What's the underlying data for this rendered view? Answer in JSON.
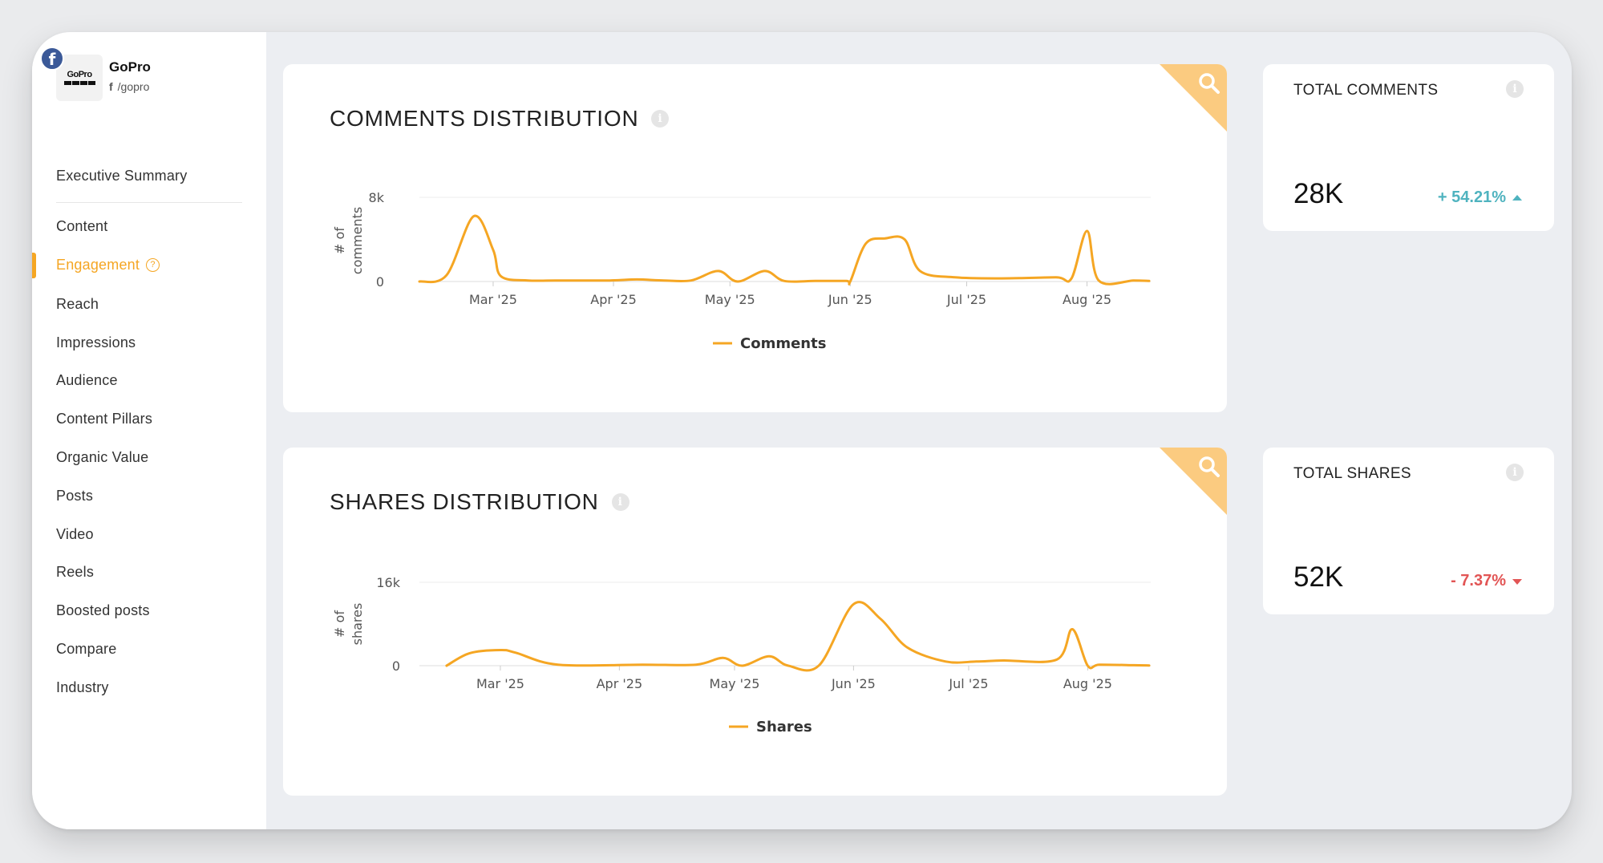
{
  "profile": {
    "name": "GoPro",
    "handle": "/gopro",
    "logo_text": "GoPro",
    "network_icon": "facebook-icon"
  },
  "nav": {
    "items": [
      {
        "label": "Executive Summary"
      },
      {
        "label": "Content"
      },
      {
        "label": "Engagement",
        "active": true
      },
      {
        "label": "Reach"
      },
      {
        "label": "Impressions"
      },
      {
        "label": "Audience"
      },
      {
        "label": "Content Pillars"
      },
      {
        "label": "Organic Value"
      },
      {
        "label": "Posts"
      },
      {
        "label": "Video"
      },
      {
        "label": "Reels"
      },
      {
        "label": "Boosted posts"
      },
      {
        "label": "Compare"
      },
      {
        "label": "Industry"
      }
    ]
  },
  "colors": {
    "accent": "#f5a623",
    "corner": "#fbcb80",
    "positive": "#4fb3bf",
    "negative": "#e25555",
    "facebook": "#3b5998"
  },
  "comments_card": {
    "title": "COMMENTS DISTRIBUTION",
    "ylabel_line1": "# of",
    "ylabel_line2": "comments",
    "legend": "Comments"
  },
  "shares_card": {
    "title": "SHARES DISTRIBUTION",
    "ylabel_line1": "# of",
    "ylabel_line2": "shares",
    "legend": "Shares"
  },
  "stats": {
    "comments": {
      "label": "TOTAL COMMENTS",
      "value": "28K",
      "change": "+ 54.21%",
      "direction": "up"
    },
    "shares": {
      "label": "TOTAL SHARES",
      "value": "52K",
      "change": "- 7.37%",
      "direction": "down"
    }
  },
  "chart_data": [
    {
      "type": "line",
      "title": "COMMENTS DISTRIBUTION",
      "xlabel": "",
      "ylabel": "# of comments",
      "ylim": [
        0,
        8000
      ],
      "yticks": [
        "0",
        "8k"
      ],
      "xticks": [
        "Mar '25",
        "Apr '25",
        "May '25",
        "Jun '25",
        "Jul '25",
        "Aug '25"
      ],
      "legend_position": "bottom",
      "grid": true,
      "series": [
        {
          "name": "Comments",
          "color": "#f5a623",
          "x": [
            "2025-02-10",
            "2025-02-17",
            "2025-02-24",
            "2025-03-01",
            "2025-03-03",
            "2025-03-10",
            "2025-03-17",
            "2025-03-31",
            "2025-04-07",
            "2025-04-14",
            "2025-04-21",
            "2025-04-28",
            "2025-05-03",
            "2025-05-10",
            "2025-05-15",
            "2025-05-23",
            "2025-05-31",
            "2025-06-01",
            "2025-06-05",
            "2025-06-10",
            "2025-06-15",
            "2025-06-19",
            "2025-06-28",
            "2025-07-10",
            "2025-07-24",
            "2025-07-28",
            "2025-08-01",
            "2025-08-04",
            "2025-08-13",
            "2025-08-17"
          ],
          "values": [
            0,
            600,
            6200,
            3000,
            500,
            100,
            100,
            100,
            200,
            100,
            100,
            1000,
            0,
            1000,
            50,
            50,
            50,
            0,
            3600,
            4100,
            4000,
            1000,
            400,
            300,
            400,
            300,
            4800,
            100,
            100,
            50
          ]
        }
      ]
    },
    {
      "type": "line",
      "title": "SHARES DISTRIBUTION",
      "xlabel": "",
      "ylabel": "# of shares",
      "ylim": [
        0,
        16000
      ],
      "yticks": [
        "0",
        "16k"
      ],
      "xticks": [
        "Mar '25",
        "Apr '25",
        "May '25",
        "Jun '25",
        "Jul '25",
        "Aug '25"
      ],
      "legend_position": "bottom",
      "grid": true,
      "series": [
        {
          "name": "Shares",
          "color": "#f5a623",
          "x": [
            "2025-02-15",
            "2025-02-21",
            "2025-03-01",
            "2025-03-05",
            "2025-03-16",
            "2025-04-07",
            "2025-04-21",
            "2025-04-28",
            "2025-05-03",
            "2025-05-10",
            "2025-05-15",
            "2025-05-23",
            "2025-06-01",
            "2025-06-08",
            "2025-06-15",
            "2025-06-25",
            "2025-07-03",
            "2025-07-10",
            "2025-07-24",
            "2025-07-28",
            "2025-08-01",
            "2025-08-04",
            "2025-08-13",
            "2025-08-17"
          ],
          "values": [
            0,
            2400,
            3000,
            2500,
            200,
            200,
            200,
            1500,
            0,
            1800,
            0,
            50,
            11800,
            9000,
            3500,
            800,
            800,
            1000,
            1200,
            7000,
            0,
            200,
            100,
            50
          ]
        }
      ]
    }
  ]
}
